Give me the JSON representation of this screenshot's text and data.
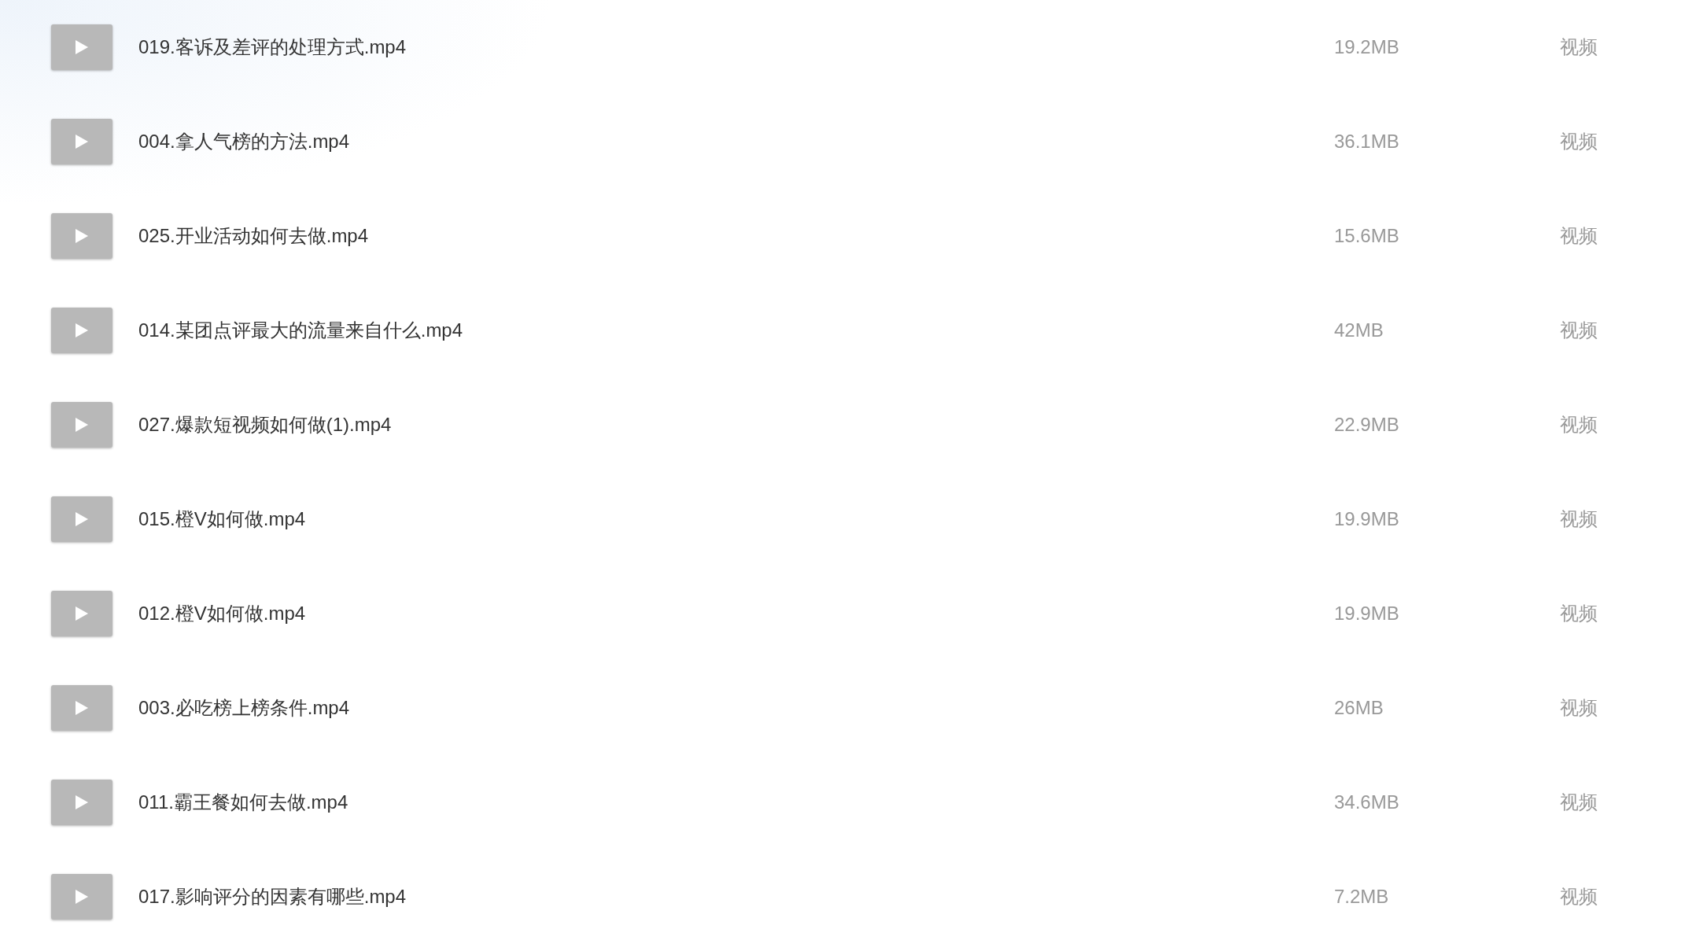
{
  "files": [
    {
      "name": "019.客诉及差评的处理方式.mp4",
      "size": "19.2MB",
      "type": "视频"
    },
    {
      "name": "004.拿人气榜的方法.mp4",
      "size": "36.1MB",
      "type": "视频"
    },
    {
      "name": "025.开业活动如何去做.mp4",
      "size": "15.6MB",
      "type": "视频"
    },
    {
      "name": "014.某团点评最大的流量来自什么.mp4",
      "size": "42MB",
      "type": "视频"
    },
    {
      "name": "027.爆款短视频如何做(1).mp4",
      "size": "22.9MB",
      "type": "视频"
    },
    {
      "name": "015.橙V如何做.mp4",
      "size": "19.9MB",
      "type": "视频"
    },
    {
      "name": "012.橙V如何做.mp4",
      "size": "19.9MB",
      "type": "视频"
    },
    {
      "name": "003.必吃榜上榜条件.mp4",
      "size": "26MB",
      "type": "视频"
    },
    {
      "name": "011.霸王餐如何去做.mp4",
      "size": "34.6MB",
      "type": "视频"
    },
    {
      "name": "017.影响评分的因素有哪些.mp4",
      "size": "7.2MB",
      "type": "视频"
    }
  ]
}
